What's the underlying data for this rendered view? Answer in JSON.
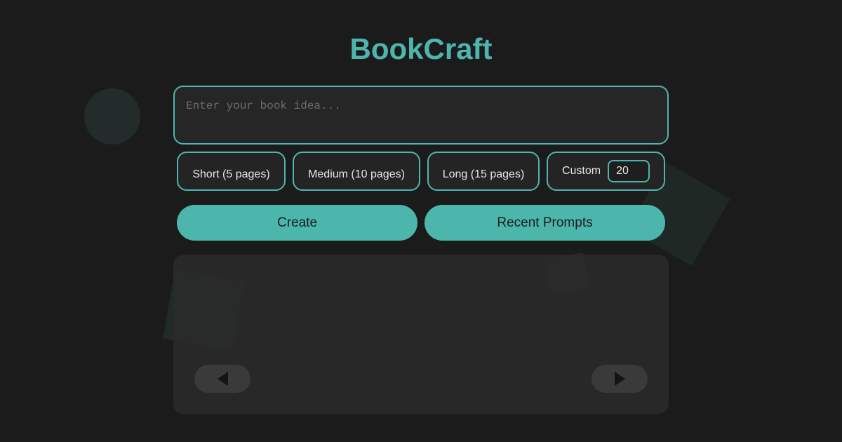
{
  "app": {
    "title": "BookCraft"
  },
  "prompt": {
    "placeholder": "Enter your book idea...",
    "value": ""
  },
  "lengths": {
    "short_label": "Short (5 pages)",
    "medium_label": "Medium (10 pages)",
    "long_label": "Long (15 pages)",
    "custom_label": "Custom",
    "custom_value": "20"
  },
  "actions": {
    "create_label": "Create",
    "recent_label": "Recent Prompts"
  },
  "viewer": {
    "prev_icon": "chevron-left-triangle",
    "next_icon": "chevron-right-triangle"
  },
  "colors": {
    "accent": "#4db6ac",
    "background": "#1b1b1b",
    "panel": "#2a2a2a"
  }
}
